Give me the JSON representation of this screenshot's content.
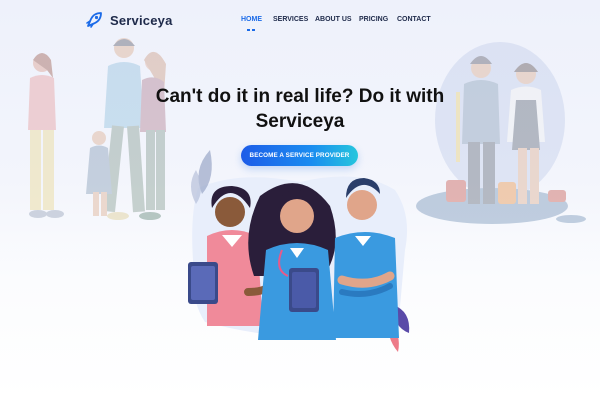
{
  "brand": {
    "name": "Serviceya",
    "logo_icon": "rocket-icon"
  },
  "nav": {
    "items": [
      {
        "label": "HOME",
        "active": true
      },
      {
        "label": "SERVICES",
        "active": false
      },
      {
        "label": "ABOUT US",
        "active": false
      },
      {
        "label": "PRICING",
        "active": false
      },
      {
        "label": "CONTACT",
        "active": false
      }
    ]
  },
  "hero": {
    "title_line1": "Can't do it in real life? Do it with",
    "title_line2": "Serviceya",
    "cta_label": "BECOME A SERVICE PROVIDER"
  },
  "colors": {
    "accent": "#1b6be8",
    "cta_start": "#1d5ce8",
    "cta_end": "#25c6dd",
    "text_dark": "#111111"
  }
}
